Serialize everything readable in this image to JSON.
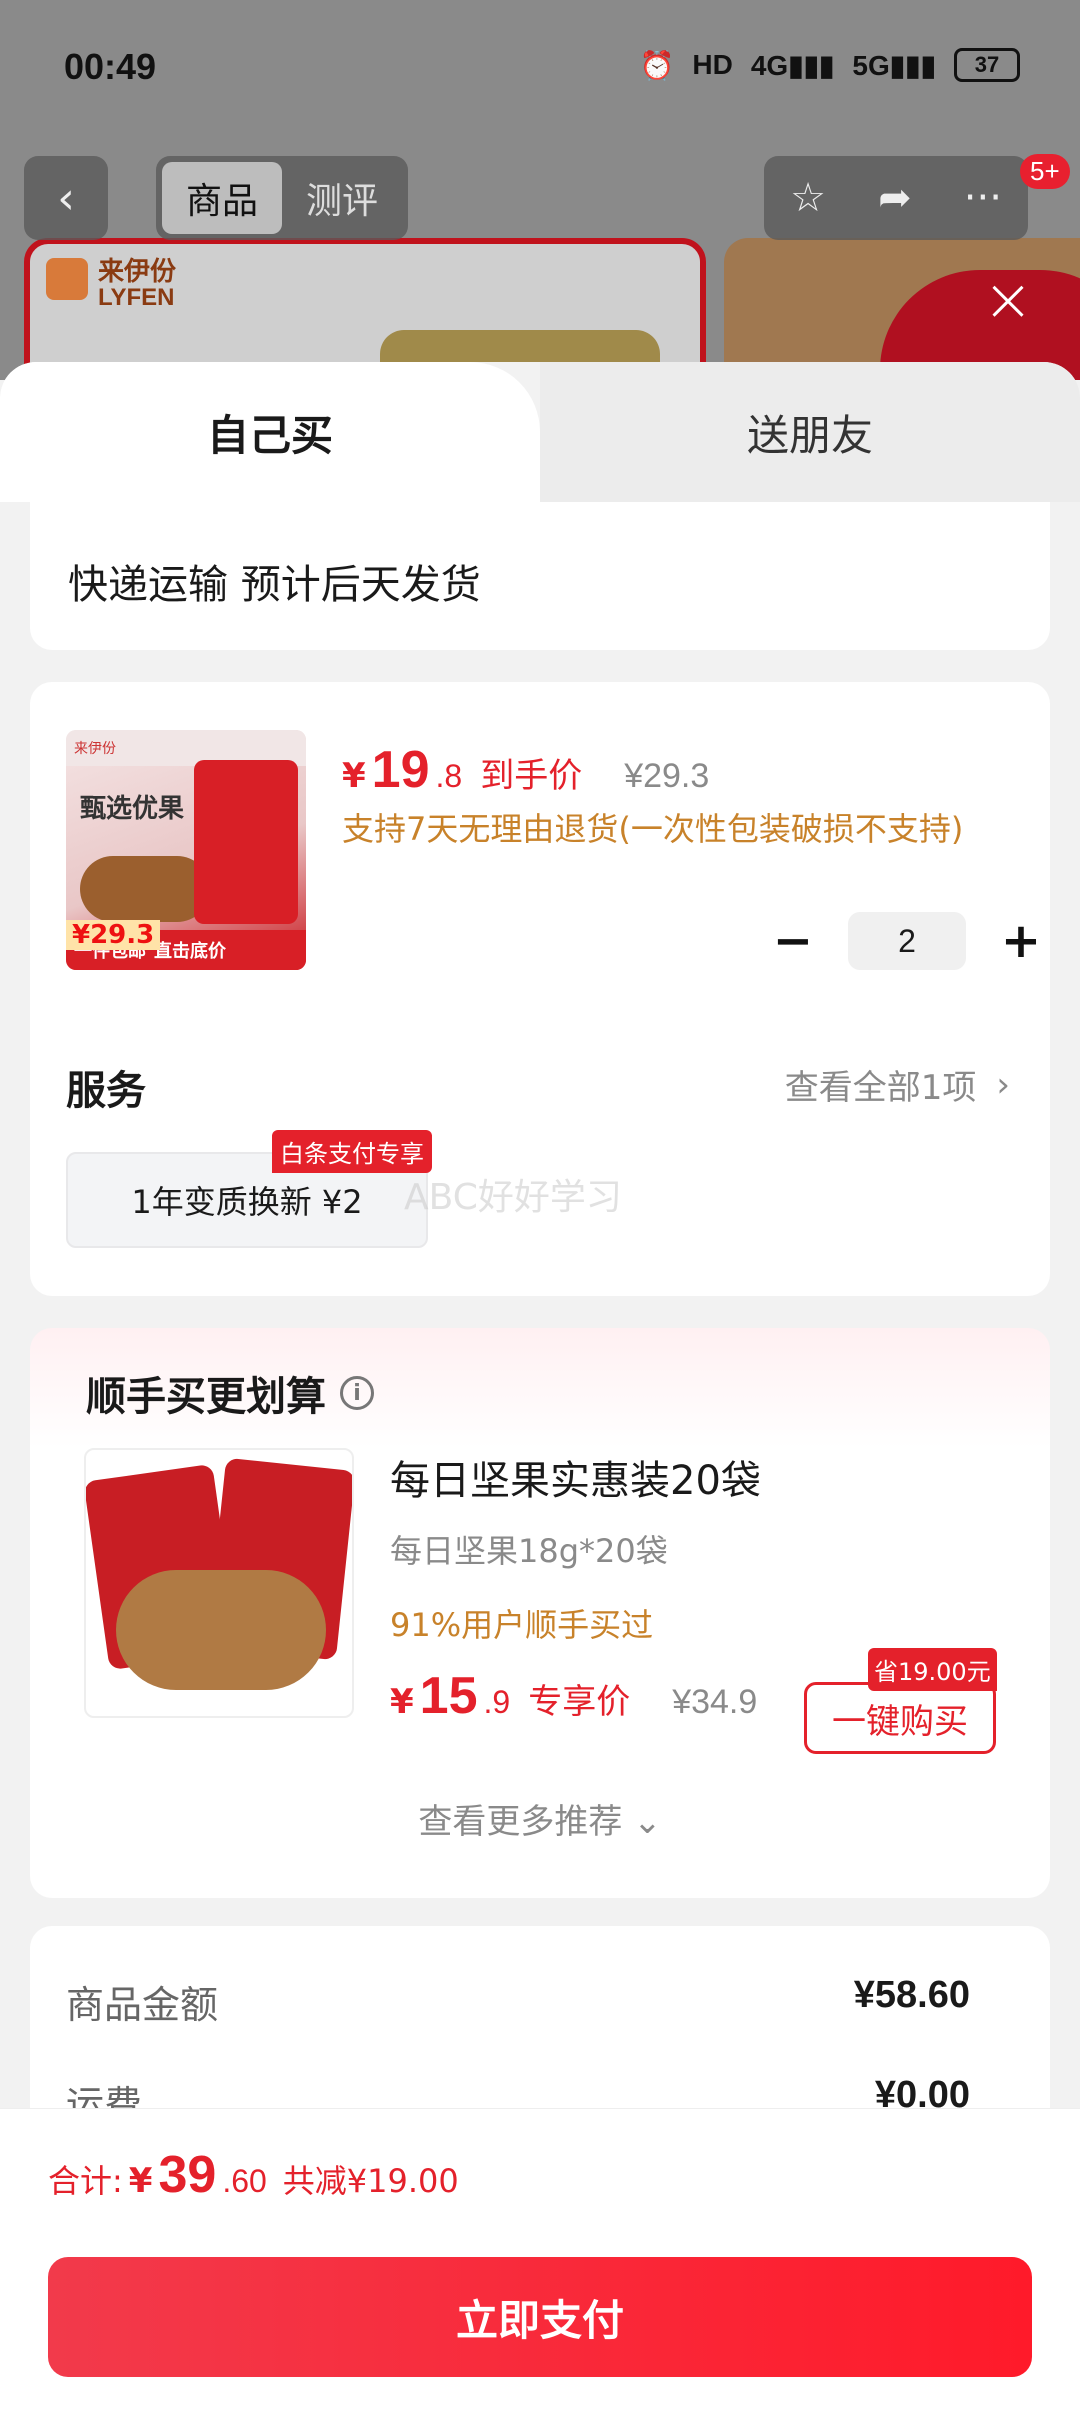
{
  "status_bar": {
    "time": "00:49",
    "icons": [
      "alarm-icon",
      "hd-icon",
      "signal-4g-icon",
      "signal-5g-icon"
    ],
    "battery": "37"
  },
  "top_nav": {
    "tabs": [
      {
        "label": "商品",
        "active": true
      },
      {
        "label": "测评",
        "active": false
      }
    ],
    "badge": "5+"
  },
  "background": {
    "brand_cn": "来伊份",
    "brand_en": "LYFEN"
  },
  "sheet": {
    "tabs": {
      "self_buy": "自己买",
      "gift_friend": "送朋友"
    },
    "delivery": "快递运输 预计后天发货",
    "product": {
      "thumb": {
        "brand": "来伊份",
        "title": "甄选优果",
        "price_tag": "¥29.3",
        "bottom_text1": "一件包邮",
        "bottom_text2": "直击底价"
      },
      "currency": "¥",
      "price_int": "19",
      "price_dec": ".8",
      "price_label": "到手价",
      "original_price": "¥29.3",
      "return_note": "支持7天无理由退货(一次性包装破损不支持)",
      "quantity": "2"
    },
    "service": {
      "title": "服务",
      "view_all": "查看全部1项",
      "chip_label": "1年变质换新  ¥2",
      "chip_badge": "白条支付专享",
      "watermark": "ABC好好学习"
    },
    "bundle": {
      "title": "顺手买更划算",
      "name": "每日坚果实惠装20袋",
      "spec": "每日坚果18g*20袋",
      "buyers_pct": "91%用户顺手买过",
      "currency": "¥",
      "price_int": "15",
      "price_dec": ".9",
      "price_label": "专享价",
      "original_price": "¥34.9",
      "save_badge": "省19.00元",
      "buy_label": "一键购买",
      "more_label": "查看更多推荐 ⌄"
    },
    "summary": {
      "rows": [
        {
          "label": "商品金额",
          "value": "¥58.60"
        },
        {
          "label": "运费",
          "value": "¥0.00"
        }
      ]
    }
  },
  "bottom_bar": {
    "total_label": "合计:",
    "currency": "¥",
    "total_int": "39",
    "total_dec": ".60",
    "discount": "共减¥19.00",
    "pay_label": "立即支付"
  },
  "colors": {
    "accent": "#e4212b",
    "orange_note": "#c8822a",
    "muted": "#8a8a8a"
  }
}
